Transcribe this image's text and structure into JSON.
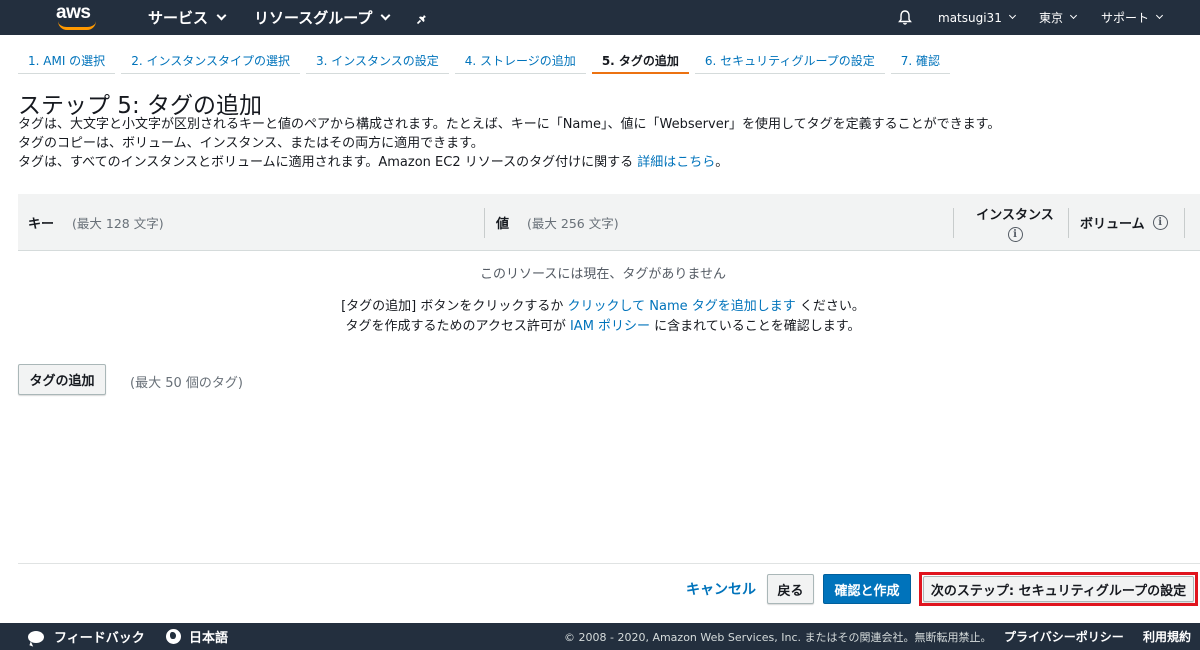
{
  "topnav": {
    "logo": "aws",
    "services": "サービス",
    "resource_groups": "リソースグループ",
    "user": "matsugi31",
    "region": "東京",
    "support": "サポート"
  },
  "wizard_tabs": [
    {
      "label": "1. AMI の選択"
    },
    {
      "label": "2. インスタンスタイプの選択"
    },
    {
      "label": "3. インスタンスの設定"
    },
    {
      "label": "4. ストレージの追加"
    },
    {
      "label": "5. タグの追加"
    },
    {
      "label": "6. セキュリティグループの設定"
    },
    {
      "label": "7. 確認"
    }
  ],
  "page": {
    "title": "ステップ 5: タグの追加",
    "desc_line1": "タグは、大文字と小文字が区別されるキーと値のペアから構成されます。たとえば、キーに「Name」、値に「Webserver」を使用してタグを定義することができます。",
    "desc_line2": "タグのコピーは、ボリューム、インスタンス、またはその両方に適用できます。",
    "desc_line3": "タグは、すべてのインスタンスとボリュームに適用されます。Amazon EC2 リソースのタグ付けに関する ",
    "desc_link": "詳細はこちら",
    "desc_end": "。"
  },
  "table": {
    "key_header": "キー",
    "key_hint": "(最大 128 文字)",
    "value_header": "値",
    "value_hint": "(最大 256 文字)",
    "instances_header": "インスタンス",
    "volumes_header": "ボリューム",
    "info_glyph": "i"
  },
  "empty": {
    "message": "このリソースには現在、タグがありません",
    "line1_pre": "[タグの追加] ボタンをクリックするか ",
    "line1_link": "クリックして Name タグを追加します",
    "line1_post": " ください。",
    "line2_pre": "タグを作成するためのアクセス許可が ",
    "line2_link": "IAM ポリシー",
    "line2_post": " に含まれていることを確認します。"
  },
  "add_tag": {
    "button": "タグの追加",
    "hint": "(最大 50 個のタグ)"
  },
  "actions": {
    "cancel": "キャンセル",
    "back": "戻る",
    "review_launch": "確認と作成",
    "next": "次のステップ: セキュリティグループの設定"
  },
  "footer": {
    "feedback": "フィードバック",
    "language": "日本語",
    "copyright": "© 2008 - 2020, Amazon Web Services, Inc. またはその関連会社。無断転用禁止。",
    "privacy": "プライバシーポリシー",
    "terms": "利用規約"
  },
  "colors": {
    "nav_bg": "#232f3e",
    "accent": "#ec7211",
    "link": "#0073bb",
    "primary": "#0073bb",
    "highlight": "#e0141e"
  }
}
